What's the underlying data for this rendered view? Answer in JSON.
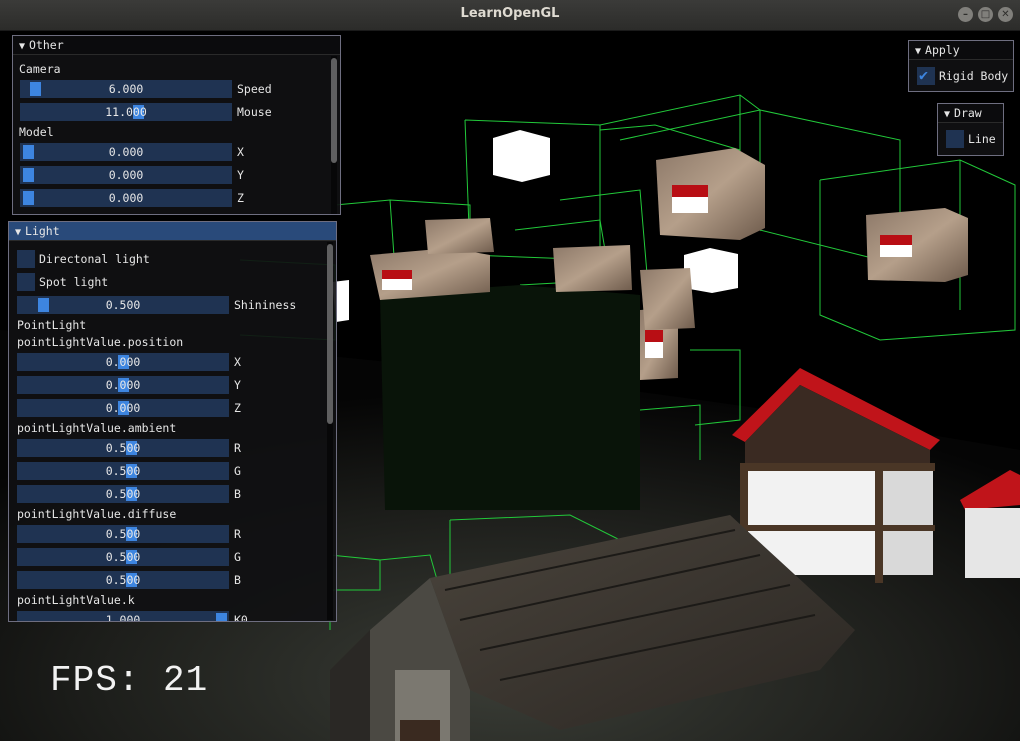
{
  "window": {
    "title": "LearnOpenGL"
  },
  "fps_text": "FPS: 21",
  "other_panel": {
    "title": "Other",
    "camera_label": "Camera",
    "speed": {
      "value": "6.000",
      "label": "Speed",
      "fraction": 0.05
    },
    "mouse": {
      "value": "11.000",
      "label": "Mouse",
      "fraction": 0.5
    },
    "model_label": "Model",
    "model_x": {
      "value": "0.000",
      "label": "X",
      "fraction": 0.0
    },
    "model_y": {
      "value": "0.000",
      "label": "Y",
      "fraction": 0.0
    },
    "model_z": {
      "value": "0.000",
      "label": "Z",
      "fraction": 0.0
    }
  },
  "light_panel": {
    "title": "Light",
    "directional_label": "Directonal light",
    "directional_checked": false,
    "spot_label": "Spot light",
    "spot_checked": false,
    "shininess": {
      "value": "0.500",
      "label": "Shininess",
      "fraction": 0.1
    },
    "point_light_label": "PointLight",
    "position_label": "pointLightValue.position",
    "pos_x": {
      "value": "0.000",
      "label": "X"
    },
    "pos_y": {
      "value": "0.000",
      "label": "Y"
    },
    "pos_z": {
      "value": "0.000",
      "label": "Z"
    },
    "ambient_label": "pointLightValue.ambient",
    "amb_r": {
      "value": "0.500",
      "label": "R"
    },
    "amb_g": {
      "value": "0.500",
      "label": "G"
    },
    "amb_b": {
      "value": "0.500",
      "label": "B"
    },
    "diffuse_label": "pointLightValue.diffuse",
    "dif_r": {
      "value": "0.500",
      "label": "R"
    },
    "dif_g": {
      "value": "0.500",
      "label": "G"
    },
    "dif_b": {
      "value": "0.500",
      "label": "B"
    },
    "k_label": "pointLightValue.k",
    "k0": {
      "value": "1.000",
      "label": "K0"
    }
  },
  "apply_panel": {
    "title": "Apply",
    "rigid_body_label": "Rigid Body",
    "rigid_body_checked": true
  },
  "draw_panel": {
    "title": "Draw",
    "line_label": "Line",
    "line_checked": false
  },
  "colors": {
    "slider_bg": "#1f3352",
    "grab": "#3d85e0",
    "header_active": "#294a7a",
    "wireframe": "#22c93a"
  }
}
